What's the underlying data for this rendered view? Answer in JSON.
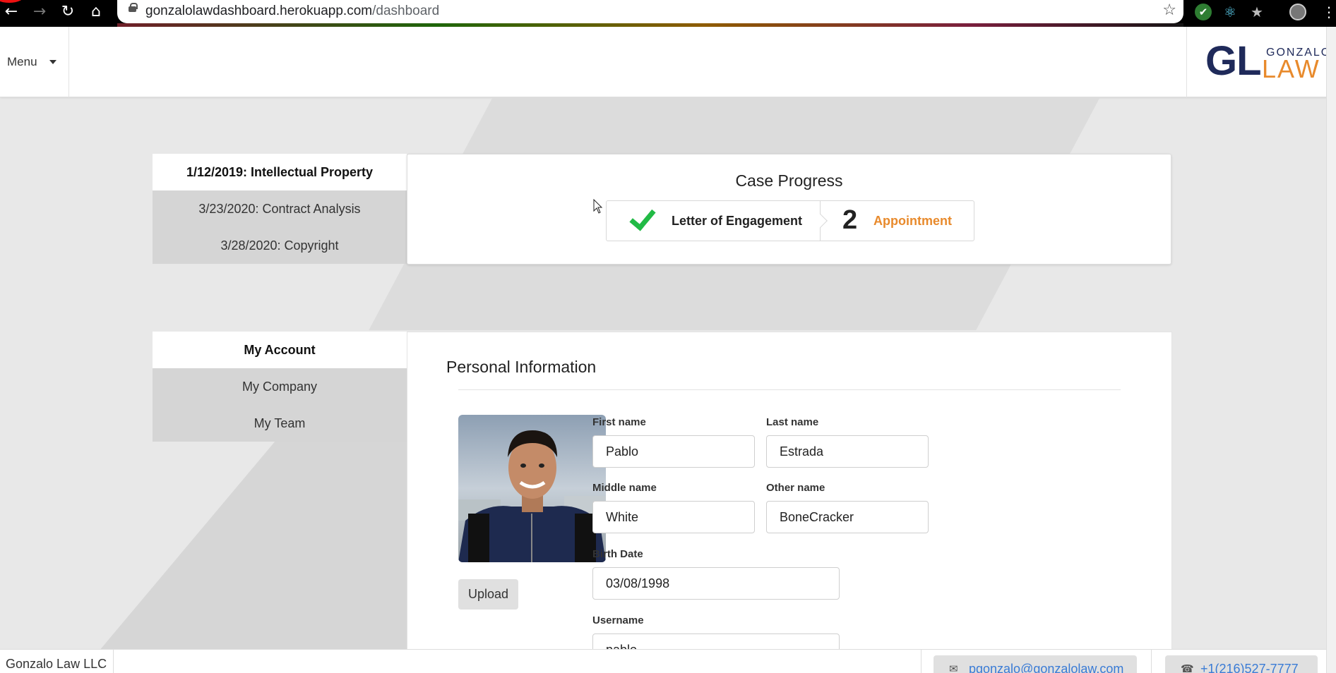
{
  "browser": {
    "url_host": "gonzalolawdashboard.herokuapp.com",
    "url_path": "/dashboard",
    "back_icon": "←",
    "forward_icon": "→",
    "reload_icon": "↻",
    "home_icon": "⌂",
    "star_icon": "☆",
    "ext_shield_icon": "✔",
    "ext_react_icon": "⚛",
    "ext_bookmark_icon": "★",
    "menu_icon": "⋮"
  },
  "header": {
    "menu_label": "Menu",
    "logo_gl": "GL",
    "logo_gonzalo": "GONZALO",
    "logo_law": "LAW"
  },
  "cases": [
    {
      "label": "1/12/2019: Intellectual Property",
      "active": true
    },
    {
      "label": "3/23/2020: Contract Analysis",
      "active": false
    },
    {
      "label": "3/28/2020: Copyright",
      "active": false
    }
  ],
  "case_progress": {
    "title": "Case Progress",
    "steps": [
      {
        "label": "Letter of Engagement",
        "status": "completed",
        "icon": "check-icon"
      },
      {
        "label": "Appointment",
        "status": "current",
        "number": "2"
      }
    ],
    "accent_color": "#e88a2c",
    "success_color": "#21ba45"
  },
  "account_nav": [
    {
      "label": "My Account",
      "active": true
    },
    {
      "label": "My Company",
      "active": false
    },
    {
      "label": "My Team",
      "active": false
    }
  ],
  "personal_info": {
    "title": "Personal Information",
    "upload_label": "Upload",
    "fields": {
      "first_name": {
        "label": "First name",
        "value": "Pablo"
      },
      "last_name": {
        "label": "Last name",
        "value": "Estrada"
      },
      "middle_name": {
        "label": "Middle name",
        "value": "White"
      },
      "other_name": {
        "label": "Other name",
        "value": "BoneCracker"
      },
      "birth_date": {
        "label": "Birth Date",
        "value": "03/08/1998"
      },
      "username": {
        "label": "Username",
        "value": "pablo"
      }
    }
  },
  "footer": {
    "company": "Gonzalo Law LLC",
    "email": "pgonzalo@gonzalolaw.com",
    "phone": "+1(216)527-7777",
    "email_icon": "✉",
    "phone_icon": "☎"
  }
}
